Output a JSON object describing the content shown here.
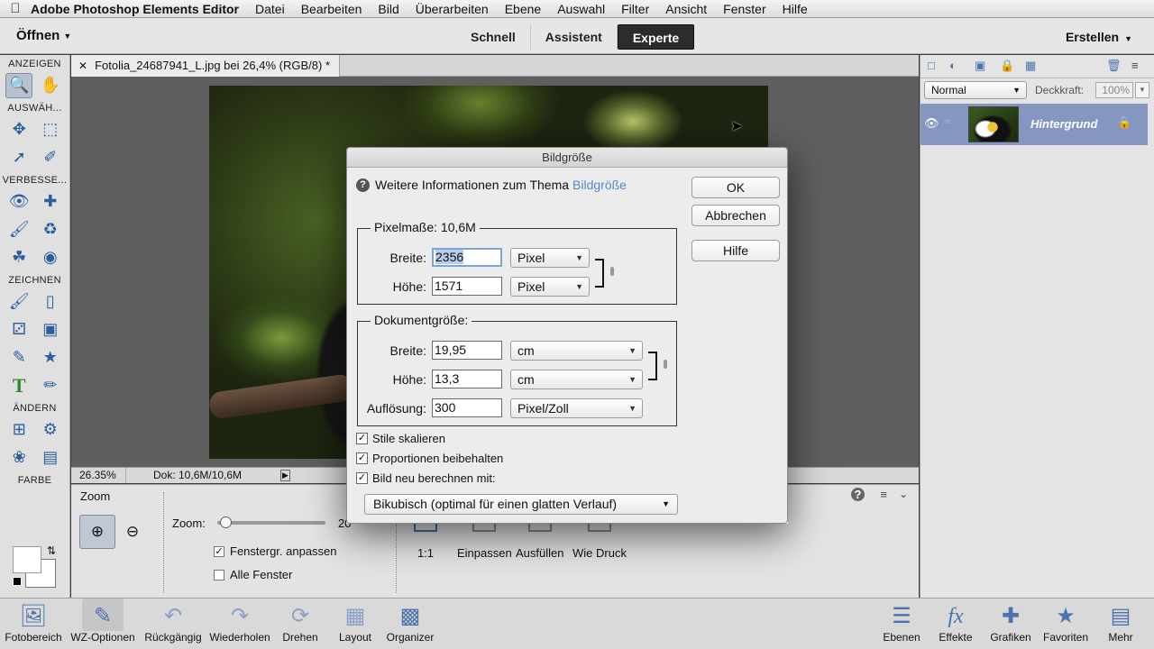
{
  "menubar": {
    "app_name": "Adobe Photoshop Elements Editor",
    "items": [
      "Datei",
      "Bearbeiten",
      "Bild",
      "Überarbeiten",
      "Ebene",
      "Auswahl",
      "Filter",
      "Ansicht",
      "Fenster",
      "Hilfe"
    ]
  },
  "topbar": {
    "open_label": "Öffnen",
    "modes": [
      "Schnell",
      "Assistent",
      "Experte"
    ],
    "active_mode": "Experte",
    "create_label": "Erstellen"
  },
  "toolbox": {
    "sections": [
      "ANZEIGEN",
      "AUSWÄH...",
      "VERBESSE...",
      "ZEICHNEN",
      "ÄNDERN",
      "FARBE"
    ]
  },
  "document": {
    "tab_title": "Fotolia_24687941_L.jpg bei 26,4% (RGB/8) *",
    "zoom_readout": "26.35%",
    "doc_info": "Dok: 10,6M/10,6M"
  },
  "tool_options": {
    "title": "Zoom",
    "zoom_label": "Zoom:",
    "zoom_max_text": "20",
    "zoom_level": 0.03,
    "check_fit_window": "Fenstergr. anpassen",
    "check_all_windows": "Alle Fenster",
    "view_buttons": [
      "1:1",
      "Einpassen",
      "Ausfüllen",
      "Wie Druck"
    ]
  },
  "layers_panel": {
    "blend_mode": "Normal",
    "opacity_label": "Deckkraft:",
    "opacity_value": "100%",
    "layer_name": "Hintergrund"
  },
  "taskbar": {
    "left": [
      "Fotobereich",
      "WZ-Optionen",
      "Rückgängig",
      "Wiederholen",
      "Drehen",
      "Layout",
      "Organizer"
    ],
    "right": [
      "Ebenen",
      "Effekte",
      "Grafiken",
      "Favoriten",
      "Mehr"
    ]
  },
  "dialog": {
    "title": "Bildgröße",
    "info_text": "Weitere Informationen zum Thema",
    "info_link": "Bildgröße",
    "ok_label": "OK",
    "cancel_label": "Abbrechen",
    "help_label": "Hilfe",
    "pixel_dimensions": {
      "legend": "Pixelmaße: 10,6M",
      "width_label": "Breite:",
      "width_value": "2356",
      "width_unit": "Pixel",
      "height_label": "Höhe:",
      "height_value": "1571",
      "height_unit": "Pixel"
    },
    "document_size": {
      "legend": "Dokumentgröße:",
      "width_label": "Breite:",
      "width_value": "19,95",
      "width_unit": "cm",
      "height_label": "Höhe:",
      "height_value": "13,3",
      "height_unit": "cm",
      "resolution_label": "Auflösung:",
      "resolution_value": "300",
      "resolution_unit": "Pixel/Zoll"
    },
    "check_scale_styles": "Stile skalieren",
    "check_constrain": "Proportionen beibehalten",
    "check_resample": "Bild neu berechnen mit:",
    "resample_method": "Bikubisch (optimal für einen glatten Verlauf)"
  }
}
